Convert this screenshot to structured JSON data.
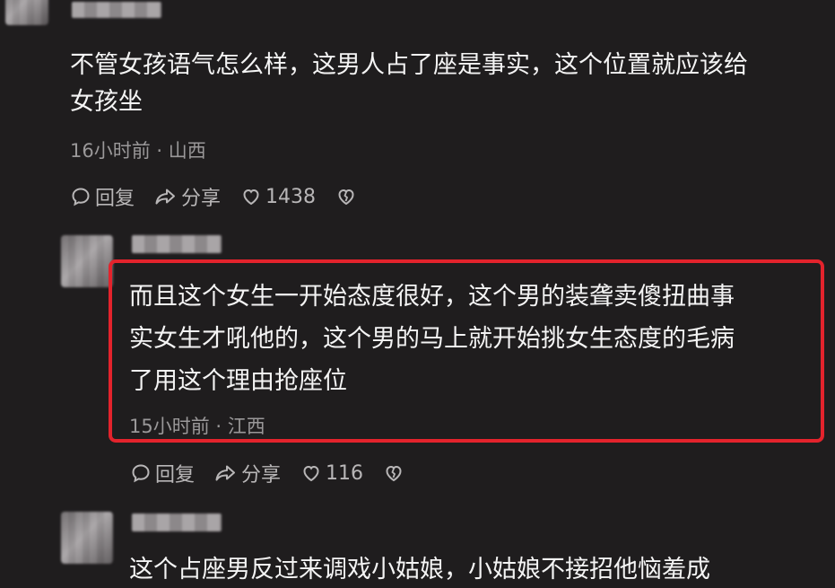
{
  "comments": [
    {
      "text_lines": [
        "不管女孩语气怎么样，这男人占了座是事实，这个位置就应该给",
        "女孩坐"
      ],
      "meta": "16小时前 · 山西",
      "reply_label": "回复",
      "share_label": "分享",
      "like_count": "1438"
    },
    {
      "text_lines": [
        "而且这个女生一开始态度很好，这个男的装聋卖傻扭曲事",
        "实女生才吼他的，这个男的马上就开始挑女生态度的毛病",
        "了用这个理由抢座位"
      ],
      "meta": "15小时前 · 江西",
      "reply_label": "回复",
      "share_label": "分享",
      "like_count": "116"
    },
    {
      "text_lines": [
        "这个占座男反过来调戏小姑娘，小姑娘不接招他恼羞成"
      ]
    }
  ],
  "icons": {
    "reply": "comment-bubble-icon",
    "share": "share-arrow-icon",
    "like": "heart-icon",
    "dislike": "broken-heart-icon"
  },
  "colors": {
    "background": "#1f1d1e",
    "highlight_border": "#e3232c",
    "meta_text": "#9a9899"
  }
}
